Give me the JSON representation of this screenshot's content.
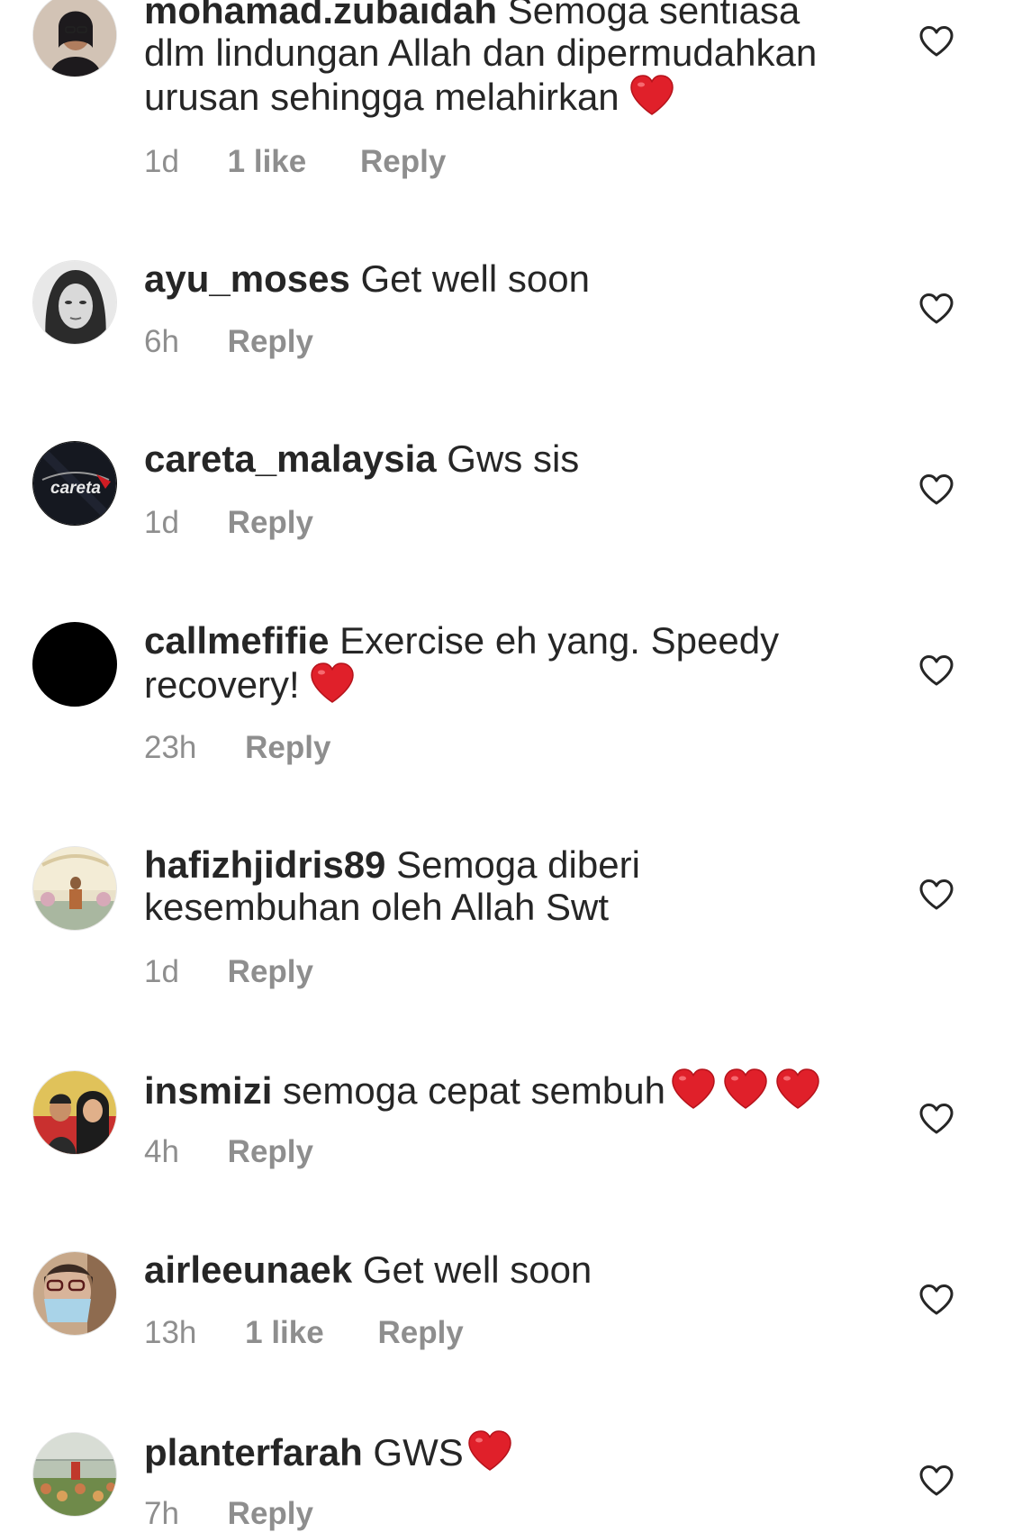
{
  "colors": {
    "text": "#262626",
    "meta": "#8e8e8e",
    "heart_emoji": "#e0202a"
  },
  "comments": [
    {
      "username": "mohamad.zubaidah",
      "text": "Semoga sentiasa dlm lindungan Allah dan dipermudahkan urusan sehingga melahirkan",
      "emoji": "red-heart",
      "time": "1d",
      "likes": "1 like",
      "reply": "Reply",
      "like_icon": "heart-outline-icon"
    },
    {
      "username": "ayu_moses",
      "text": "Get well soon",
      "time": "6h",
      "likes": "",
      "reply": "Reply",
      "like_icon": "heart-outline-icon"
    },
    {
      "username": "careta_malaysia",
      "text": "Gws sis",
      "time": "1d",
      "likes": "",
      "reply": "Reply",
      "like_icon": "heart-outline-icon",
      "avatar_logo_text": "careta"
    },
    {
      "username": "callmefifie",
      "text": "Exercise eh yang. Speedy recovery!",
      "emoji": "red-heart",
      "time": "23h",
      "likes": "",
      "reply": "Reply",
      "like_icon": "heart-outline-icon"
    },
    {
      "username": "hafizhjidris89",
      "text": "Semoga diberi kesembuhan oleh Allah Swt",
      "time": "1d",
      "likes": "",
      "reply": "Reply",
      "like_icon": "heart-outline-icon"
    },
    {
      "username": "insmizi",
      "text": "semoga cepat sembuh",
      "emoji": "red-heart x3",
      "time": "4h",
      "likes": "",
      "reply": "Reply",
      "like_icon": "heart-outline-icon"
    },
    {
      "username": "airleeunaek",
      "text": "Get well soon",
      "time": "13h",
      "likes": "1 like",
      "reply": "Reply",
      "like_icon": "heart-outline-icon"
    },
    {
      "username": "planterfarah",
      "text": "GWS",
      "emoji": "red-heart",
      "time": "7h",
      "likes": "",
      "reply": "Reply",
      "like_icon": "heart-outline-icon"
    }
  ]
}
